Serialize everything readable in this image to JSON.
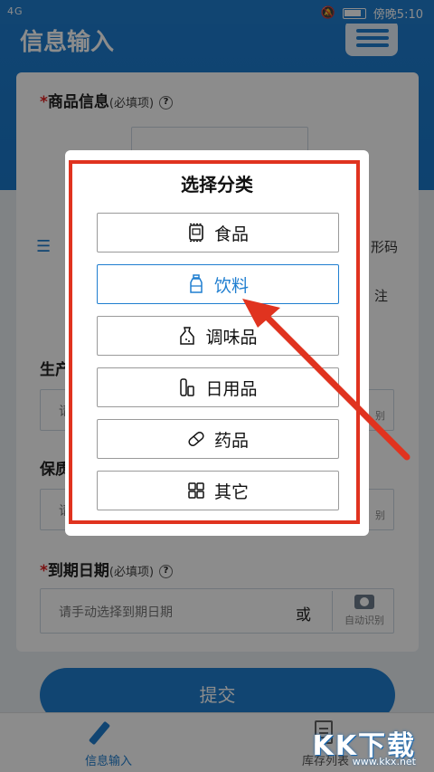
{
  "status": {
    "signal": "4G",
    "time": "傍晚5:10"
  },
  "header": {
    "title": "信息输入"
  },
  "form": {
    "product_label": "商品信息",
    "required_hint": "(必填项)",
    "required_mark": "*",
    "barcode_fragment": "形码",
    "note_fragment": "注",
    "produce_fragment": "生产",
    "shelf_fragment": "保质",
    "placeholder_fragment": "请",
    "expiry_label": "到期日期",
    "expiry_placeholder": "请手动选择到期日期",
    "or_text": "或",
    "auto_recognize": "自动识别",
    "auto_fragment": "别",
    "submit": "提交"
  },
  "dialog": {
    "title": "选择分类",
    "options": [
      {
        "label": "食品",
        "icon": "food-box-icon",
        "selected": false
      },
      {
        "label": "饮料",
        "icon": "bottle-icon",
        "selected": true
      },
      {
        "label": "调味品",
        "icon": "seasoning-bag-icon",
        "selected": false
      },
      {
        "label": "日用品",
        "icon": "daily-goods-icon",
        "selected": false
      },
      {
        "label": "药品",
        "icon": "pill-icon",
        "selected": false
      },
      {
        "label": "其它",
        "icon": "grid-icon",
        "selected": false
      }
    ]
  },
  "nav": {
    "items": [
      {
        "label": "信息输入",
        "icon": "pencil-icon",
        "active": true
      },
      {
        "label": "库存列表",
        "icon": "document-icon",
        "active": false
      }
    ]
  },
  "watermark": {
    "text": "KK下载",
    "url": "www.kkx.net"
  },
  "colors": {
    "primary": "#1f7ed0",
    "highlight": "#e0331f"
  }
}
